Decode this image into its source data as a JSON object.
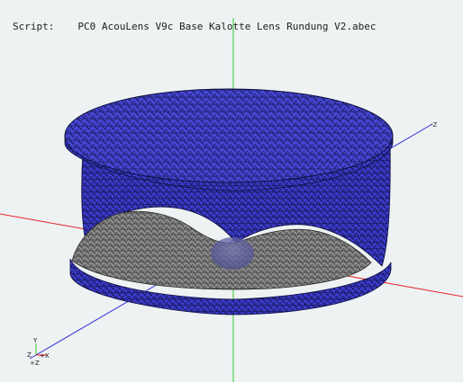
{
  "header": {
    "script_label": "Script:",
    "script_file": "PC0 AcouLens V9c Base Kalotte Lens Rundung V2.abec"
  },
  "axes": {
    "z_label": "-Z"
  },
  "triad": {
    "y": "Y",
    "z": "Z",
    "x": "+X",
    "z2": "+Z"
  },
  "colors": {
    "background": "#eef2f3",
    "mesh_blue": "#4a4ad8",
    "mesh_gray": "#8c8c8c",
    "axis_x": "#e8262a",
    "axis_y": "#2ecf2e",
    "axis_z": "#2b2bd8"
  }
}
